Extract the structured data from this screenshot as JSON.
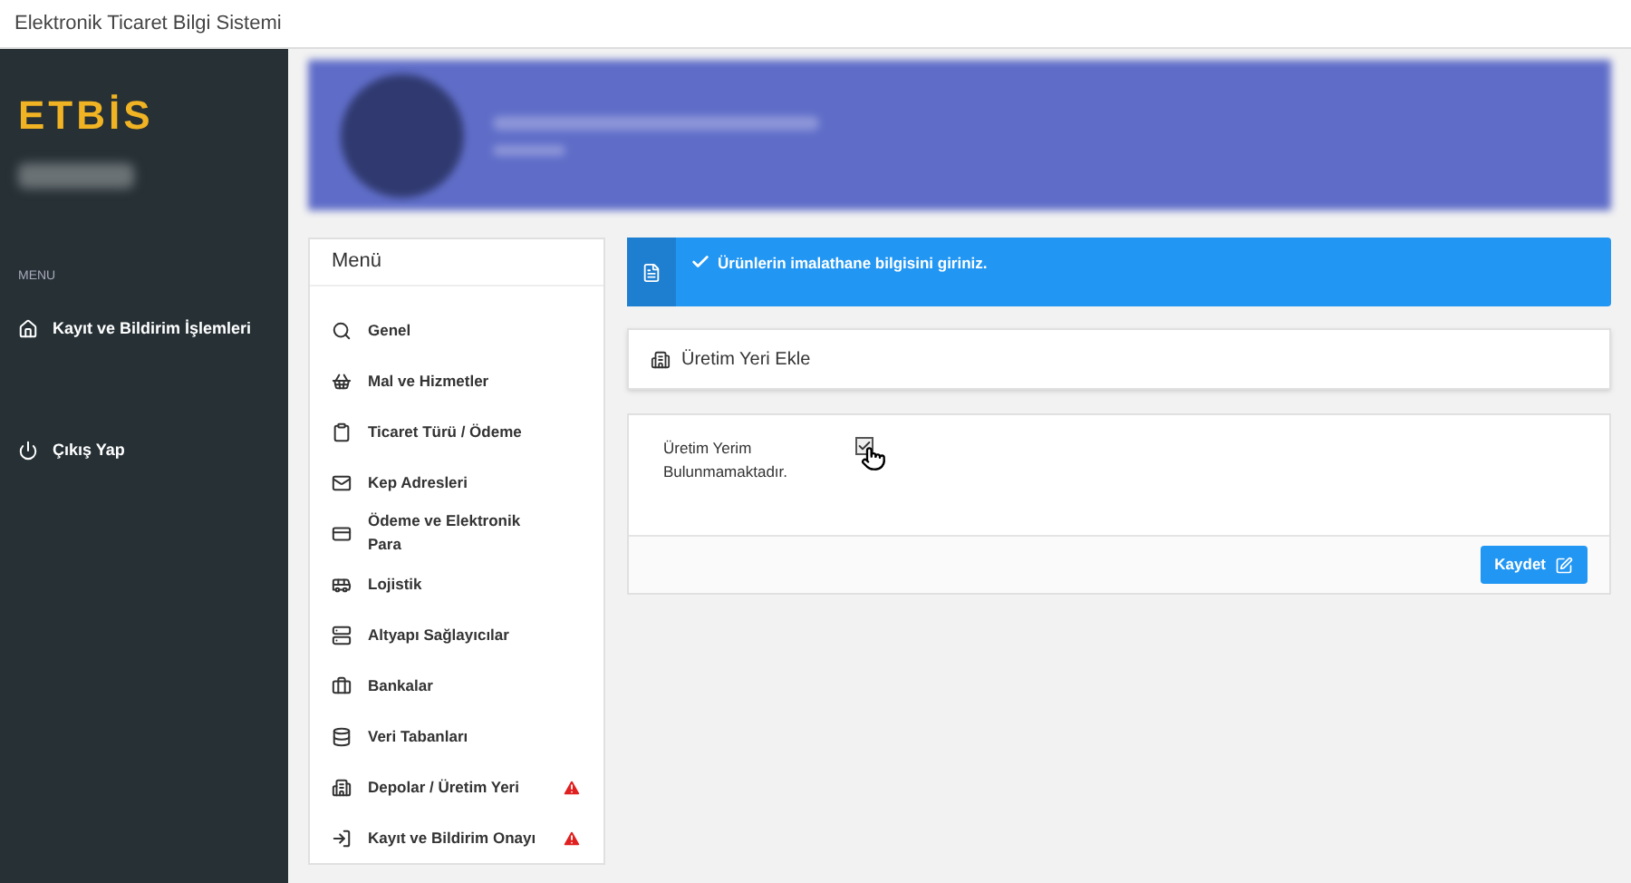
{
  "window": {
    "title": "Elektronik Ticaret Bilgi Sistemi"
  },
  "sidebar": {
    "logo": "ETBİS",
    "section": "MENU",
    "items": [
      {
        "kind": "home",
        "label": "Kayıt ve Bildirim İşlemleri"
      },
      {
        "kind": "power",
        "label": "Çıkış Yap"
      }
    ]
  },
  "menu": {
    "title": "Menü",
    "items": [
      {
        "kind": "search",
        "label": "Genel",
        "warning": false
      },
      {
        "kind": "basket",
        "label": "Mal ve Hizmetler",
        "warning": false
      },
      {
        "kind": "clipboard",
        "label": "Ticaret Türü / Ödeme",
        "warning": false
      },
      {
        "kind": "mail",
        "label": "Kep Adresleri",
        "warning": false
      },
      {
        "kind": "card",
        "label": "Ödeme ve Elektronik Para",
        "warning": false
      },
      {
        "kind": "bus",
        "label": "Lojistik",
        "warning": false
      },
      {
        "kind": "server",
        "label": "Altyapı Sağlayıcılar",
        "warning": false
      },
      {
        "kind": "briefcase",
        "label": "Bankalar",
        "warning": false
      },
      {
        "kind": "database",
        "label": "Veri Tabanları",
        "warning": false
      },
      {
        "kind": "building",
        "label": "Depolar / Üretim Yeri",
        "warning": true
      },
      {
        "kind": "login",
        "label": "Kayıt ve Bildirim Onayı",
        "warning": true
      }
    ]
  },
  "alert": {
    "message": "Ürünlerin imalathane bilgisini giriniz."
  },
  "section": {
    "title": "Üretim Yeri Ekle"
  },
  "form": {
    "checkbox_label": "Üretim Yerim Bulunmamaktadır.",
    "checked": true,
    "save_button": "Kaydet"
  }
}
